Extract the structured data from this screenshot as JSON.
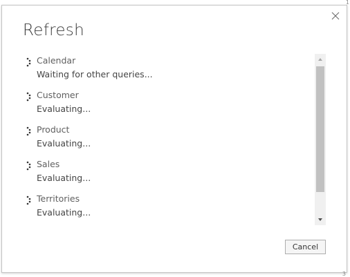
{
  "dialog": {
    "title": "Refresh",
    "close_icon": "close-icon",
    "cancel_label": "Cancel"
  },
  "edge_marks": {
    "top": "1",
    "bottom": "3"
  },
  "queries": [
    {
      "name": "Calendar",
      "status": "Waiting for other queries...",
      "icon": "loading-spinner-icon"
    },
    {
      "name": "Customer",
      "status": "Evaluating...",
      "icon": "loading-spinner-icon"
    },
    {
      "name": "Product",
      "status": "Evaluating...",
      "icon": "loading-spinner-icon"
    },
    {
      "name": "Sales",
      "status": "Evaluating...",
      "icon": "loading-spinner-icon"
    },
    {
      "name": "Territories",
      "status": "Evaluating...",
      "icon": "loading-spinner-icon"
    }
  ],
  "scrollbar": {
    "up_icon": "scroll-up-arrow-icon",
    "down_icon": "scroll-down-arrow-icon"
  },
  "colors": {
    "dialog_border": "#c4c4c4",
    "scroll_track": "#f0f0f0",
    "scroll_thumb": "#c1c1c1",
    "button_border": "#adadad"
  }
}
